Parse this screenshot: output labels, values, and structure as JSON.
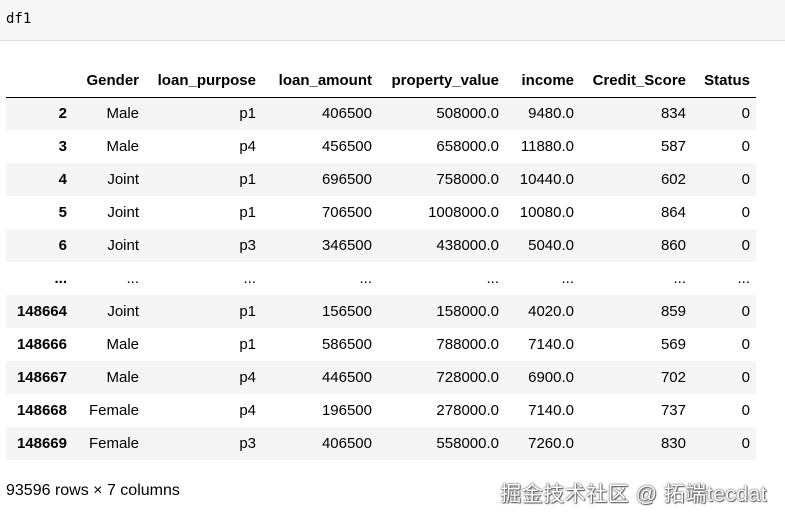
{
  "code_cell": {
    "input": "df1"
  },
  "table": {
    "columns": [
      "Gender",
      "loan_purpose",
      "loan_amount",
      "property_value",
      "income",
      "Credit_Score",
      "Status"
    ],
    "rows": [
      {
        "index": "2",
        "cells": [
          "Male",
          "p1",
          "406500",
          "508000.0",
          "9480.0",
          "834",
          "0"
        ]
      },
      {
        "index": "3",
        "cells": [
          "Male",
          "p4",
          "456500",
          "658000.0",
          "11880.0",
          "587",
          "0"
        ]
      },
      {
        "index": "4",
        "cells": [
          "Joint",
          "p1",
          "696500",
          "758000.0",
          "10440.0",
          "602",
          "0"
        ]
      },
      {
        "index": "5",
        "cells": [
          "Joint",
          "p1",
          "706500",
          "1008000.0",
          "10080.0",
          "864",
          "0"
        ]
      },
      {
        "index": "6",
        "cells": [
          "Joint",
          "p3",
          "346500",
          "438000.0",
          "5040.0",
          "860",
          "0"
        ]
      },
      {
        "index": "...",
        "cells": [
          "...",
          "...",
          "...",
          "...",
          "...",
          "...",
          "..."
        ]
      },
      {
        "index": "148664",
        "cells": [
          "Joint",
          "p1",
          "156500",
          "158000.0",
          "4020.0",
          "859",
          "0"
        ]
      },
      {
        "index": "148666",
        "cells": [
          "Male",
          "p1",
          "586500",
          "788000.0",
          "7140.0",
          "569",
          "0"
        ]
      },
      {
        "index": "148667",
        "cells": [
          "Male",
          "p4",
          "446500",
          "728000.0",
          "6900.0",
          "702",
          "0"
        ]
      },
      {
        "index": "148668",
        "cells": [
          "Female",
          "p4",
          "196500",
          "278000.0",
          "7140.0",
          "737",
          "0"
        ]
      },
      {
        "index": "148669",
        "cells": [
          "Female",
          "p3",
          "406500",
          "558000.0",
          "7260.0",
          "830",
          "0"
        ]
      }
    ]
  },
  "shape_text": "93596 rows × 7 columns",
  "watermark": "掘金技术社区 @ 拓端tecdat"
}
